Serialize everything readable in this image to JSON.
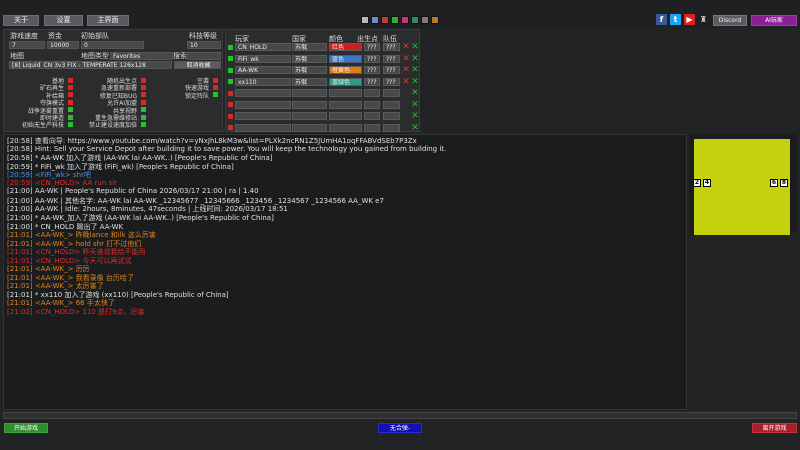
{
  "topbar": {
    "buttons": [
      "关于",
      "设置",
      "主界面"
    ],
    "swatches": [
      "#b5b8bd",
      "#6b8fd6",
      "#c23a36",
      "#2bb52b",
      "#c6347c",
      "#2f8d62",
      "#7b7b7d",
      "#b67a2c"
    ],
    "social_icons": [
      "facebook-icon",
      "twitter-icon",
      "youtube-icon",
      "trophy-icon"
    ],
    "discord": "Discord",
    "ai_player": "AI玩家"
  },
  "settings": {
    "labels": {
      "speed": "游戏速度",
      "money": "资金",
      "initial_units": "初始部队",
      "tech": "科技等级",
      "map": "地图",
      "map_type": "地图类型",
      "search": "搜索"
    },
    "values": {
      "speed": "7",
      "money": "10000",
      "initial_units": "0",
      "tech": "10",
      "map_type": "Favorites",
      "map": "[8] Liquid_CN 3v3 FIX - TEMPERATE 126x128"
    },
    "cancel_fav": "取消收藏",
    "options_left": [
      "基地",
      "矿石再生",
      "补给箱",
      "夺旗模式",
      "战争迷雾重置",
      "即时建造",
      "初始无生产科技"
    ],
    "options_left_state": [
      false,
      false,
      false,
      false,
      true,
      true,
      true
    ],
    "options_mid": [
      "随机出生点",
      "急速重新部署",
      "修复已知BUG",
      "允许AI加盟",
      "共享视野",
      "重生急需维修站",
      "禁止建设速度加倍"
    ],
    "options_mid_state": [
      false,
      false,
      false,
      false,
      true,
      true,
      true
    ],
    "options_right": [
      "空袭",
      "快速游戏",
      "锁定阵队"
    ],
    "options_right_state": [
      false,
      false,
      true
    ]
  },
  "players": {
    "headers": [
      "玩家",
      "国家",
      "颜色",
      "出生点",
      "队伍"
    ],
    "rows": [
      {
        "name": "CN_HOLD",
        "country": "苏俄",
        "color": "红色",
        "color_hex": "#cc2020",
        "spawn": "???",
        "team": "???"
      },
      {
        "name": "FiFi_wk",
        "country": "苏俄",
        "color": "蓝色",
        "color_hex": "#3c74c9",
        "spawn": "???",
        "team": "???"
      },
      {
        "name": "AA-WK_",
        "country": "苏俄",
        "color": "橙黄色",
        "color_hex": "#e07b12",
        "spawn": "???",
        "team": "???"
      },
      {
        "name": "xx110",
        "country": "苏俄",
        "color": "蓝绿色",
        "color_hex": "#2e9b83",
        "spawn": "???",
        "team": "???"
      }
    ]
  },
  "chat": [
    {
      "text": "[20:58] 查看向导: https://www.youtube.com/watch?v=yNxJhL8kM3w&list=PLXk2ncRN1Z5JUmHA1oqFFABVdSEb7P3Zx",
      "color": "#e0e0e0"
    },
    {
      "text": "[20:58] Hint: Sell your Service Depot after building it to save power. You will keep the technology you gained from building it.",
      "color": "#e0e0e0"
    },
    {
      "text": "[20:58] * AA-WK 加入了游戏 (AA-WK lai AA-WK..) [People's Republic of China]",
      "color": "#e0e0e0"
    },
    {
      "text": "[20:59] * FiFi_wk 加入了游戏 (FiFi_wk) [People's Republic of China]",
      "color": "#e0e0e0"
    },
    {
      "text": "[20:59] <FiFi_wk> shr吧",
      "color": "#4d8fe0"
    },
    {
      "text": "[20:59] <CN_HOLD> AA run sir",
      "color": "#e02a2a"
    },
    {
      "text": "[21:00] AA-WK | People's Republic of China 2026/03/17 21:00 | ra | 1.40",
      "color": "#e0e0e0"
    },
    {
      "text": "[21:00] AA-WK | 其他名字: AA-WK lai AA-WK _12345677 _12345666 _123456 _1234567 _1234566 AA_WK e7",
      "color": "#e0e0e0"
    },
    {
      "text": "[21:00] AA-WK | Idle: 2hours, 8minutes, 47seconds | 上线时间: 2026/03/17 18:51",
      "color": "#e0e0e0"
    },
    {
      "text": "[21:00] * AA-WK_加入了游戏 (AA-WK lai AA-WK..) [People's Republic of China]",
      "color": "#e0e0e0"
    },
    {
      "text": "[21:00] * CN_HOLD 踢出了 AA-WK",
      "color": "#e0e0e0"
    },
    {
      "text": "[21:01] <AA-WK_> 昨晚lance 和ilk 这么厉害",
      "color": "#e0851a"
    },
    {
      "text": "[21:01] <AA-WK_> hold  shr 打不过他们",
      "color": "#e0851a"
    },
    {
      "text": "[21:01] <CN_HOLD> 昨天谁说我给不能用",
      "color": "#e02a2a"
    },
    {
      "text": "[21:01] <CN_HOLD> 今天可以再试试",
      "color": "#e02a2a"
    },
    {
      "text": "[21:01] <AA-WK_> 厉厉",
      "color": "#e0851a"
    },
    {
      "text": "[21:01] <AA-WK_> 我看录像 台历哈了",
      "color": "#e0851a"
    },
    {
      "text": "[21:01] <AA-WK_> 太厉害了",
      "color": "#e0851a"
    },
    {
      "text": "[21:01] * xx110 加入了游戏 (xx110) [People's Republic of China]",
      "color": "#e0e0e0"
    },
    {
      "text": "[21:01] <AA-WK_> 66  手太快了",
      "color": "#e0851a"
    },
    {
      "text": "[21:02] <CN_HOLD> 110 是打9点，厉害",
      "color": "#e02a2a"
    }
  ],
  "map": {
    "spawns_left": [
      "2",
      "4"
    ],
    "spawns_right": [
      "6",
      "8"
    ]
  },
  "bottom": {
    "start": "开始游戏",
    "status": "无合弹-",
    "leave": "离开游戏"
  }
}
